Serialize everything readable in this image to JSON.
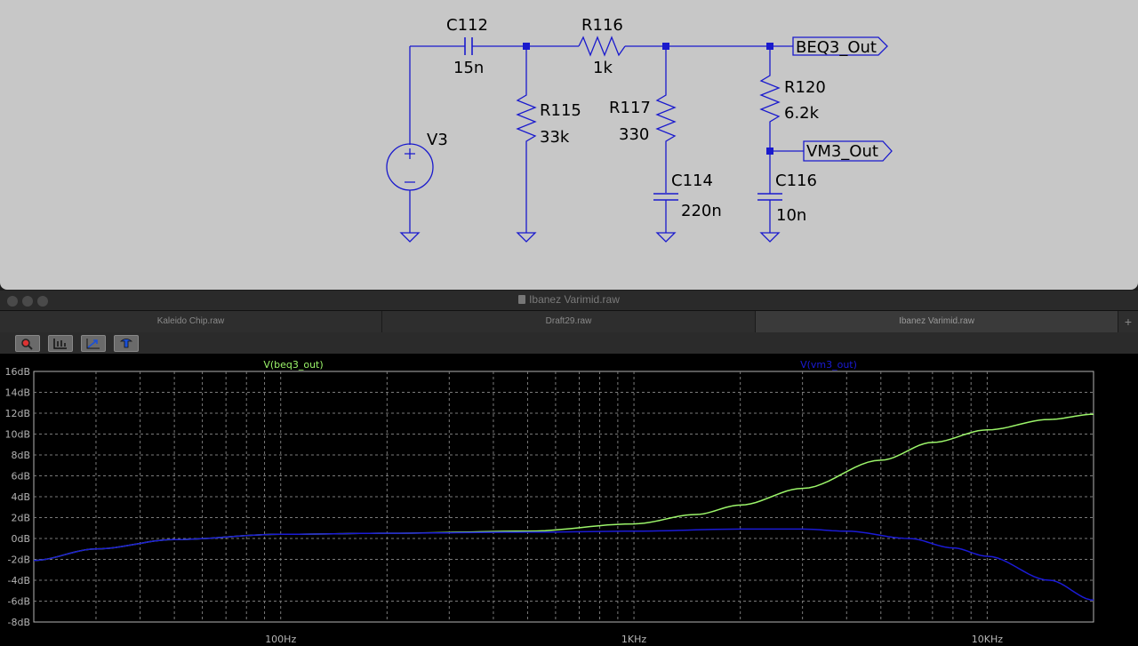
{
  "schematic": {
    "components": {
      "c112": {
        "name": "C112",
        "value": "15n"
      },
      "r116": {
        "name": "R116",
        "value": "1k"
      },
      "r115": {
        "name": "R115",
        "value": "33k"
      },
      "r117": {
        "name": "R117",
        "value": "330"
      },
      "c114": {
        "name": "C114",
        "value": "220n"
      },
      "r120": {
        "name": "R120",
        "value": "6.2k"
      },
      "c116": {
        "name": "C116",
        "value": "10n"
      },
      "v3": {
        "name": "V3"
      }
    },
    "net_labels": {
      "beq3": "BEQ3_Out",
      "vm3": "VM3_Out"
    },
    "colors": {
      "wire": "#1a1acd",
      "junction": "#1a1acd",
      "background": "#c7c7c7"
    }
  },
  "window": {
    "title": "Ibanez Varimid.raw"
  },
  "tabs": [
    {
      "label": "Kaleido Chip.raw",
      "active": false
    },
    {
      "label": "Draft29.raw",
      "active": false
    },
    {
      "label": "Ibanez Varimid.raw",
      "active": true
    }
  ],
  "tab_add": "+",
  "toolbar": {
    "buttons": [
      "zoom-icon",
      "autorange-icon",
      "unzoom-icon",
      "pan-icon"
    ]
  },
  "chart_data": {
    "type": "line",
    "x_scale": "log",
    "xlim": [
      20,
      20000
    ],
    "ylim": [
      -8,
      16
    ],
    "y_ticks": [
      "16dB",
      "14dB",
      "12dB",
      "10dB",
      "8dB",
      "6dB",
      "4dB",
      "2dB",
      "0dB",
      "-2dB",
      "-4dB",
      "-6dB",
      "-8dB"
    ],
    "x_ticks": [
      {
        "value": 100,
        "label": "100Hz"
      },
      {
        "value": 1000,
        "label": "1KHz"
      },
      {
        "value": 10000,
        "label": "10KHz"
      }
    ],
    "grid": true,
    "series": [
      {
        "name": "V(beq3_out)",
        "color": "#9cf56a",
        "x": [
          20,
          30,
          50,
          100,
          200,
          500,
          1000,
          1500,
          2000,
          3000,
          5000,
          7000,
          10000,
          15000,
          20000
        ],
        "y": [
          -2.1,
          -1.0,
          -0.1,
          0.4,
          0.5,
          0.7,
          1.4,
          2.3,
          3.2,
          4.8,
          7.5,
          9.2,
          10.4,
          11.4,
          11.9
        ]
      },
      {
        "name": "V(vm3_out)",
        "color": "#1b1bd6",
        "x": [
          20,
          30,
          50,
          100,
          200,
          500,
          1000,
          2000,
          3000,
          4000,
          6000,
          8000,
          10000,
          15000,
          20000
        ],
        "y": [
          -2.1,
          -1.0,
          -0.1,
          0.4,
          0.5,
          0.6,
          0.7,
          0.9,
          0.9,
          0.7,
          0.0,
          -0.9,
          -1.7,
          -4.0,
          -5.9
        ]
      }
    ]
  }
}
